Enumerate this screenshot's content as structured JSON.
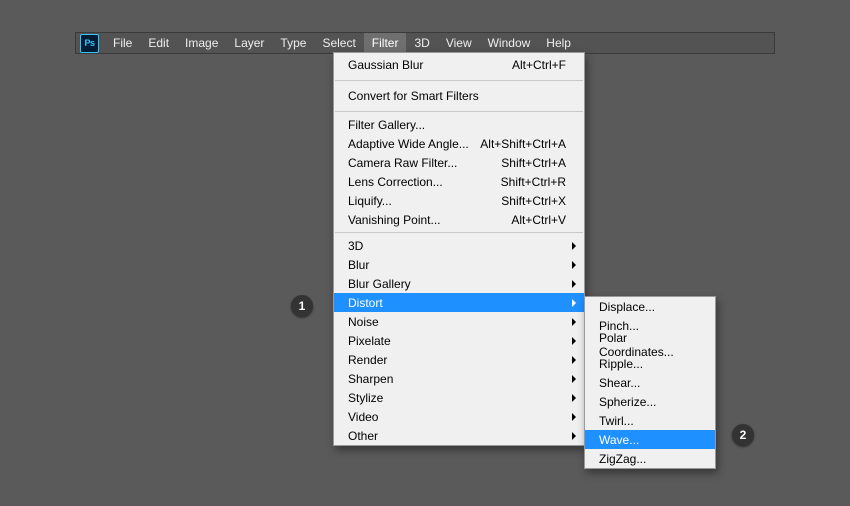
{
  "app_logo": "Ps",
  "menubar": {
    "items": [
      "File",
      "Edit",
      "Image",
      "Layer",
      "Type",
      "Select",
      "Filter",
      "3D",
      "View",
      "Window",
      "Help"
    ],
    "activeIndex": 6
  },
  "filter_menu": {
    "last": {
      "label": "Gaussian Blur",
      "shortcut": "Alt+Ctrl+F"
    },
    "smart": "Convert for Smart Filters",
    "group2": [
      {
        "label": "Filter Gallery...",
        "shortcut": ""
      },
      {
        "label": "Adaptive Wide Angle...",
        "shortcut": "Alt+Shift+Ctrl+A"
      },
      {
        "label": "Camera Raw Filter...",
        "shortcut": "Shift+Ctrl+A"
      },
      {
        "label": "Lens Correction...",
        "shortcut": "Shift+Ctrl+R"
      },
      {
        "label": "Liquify...",
        "shortcut": "Shift+Ctrl+X"
      },
      {
        "label": "Vanishing Point...",
        "shortcut": "Alt+Ctrl+V"
      }
    ],
    "submenus": [
      "3D",
      "Blur",
      "Blur Gallery",
      "Distort",
      "Noise",
      "Pixelate",
      "Render",
      "Sharpen",
      "Stylize",
      "Video",
      "Other"
    ],
    "highlightIndex": 3
  },
  "distort_submenu": {
    "items": [
      "Displace...",
      "Pinch...",
      "Polar Coordinates...",
      "Ripple...",
      "Shear...",
      "Spherize...",
      "Twirl...",
      "Wave...",
      "ZigZag..."
    ],
    "highlightIndex": 7
  },
  "callouts": {
    "one": "1",
    "two": "2"
  }
}
